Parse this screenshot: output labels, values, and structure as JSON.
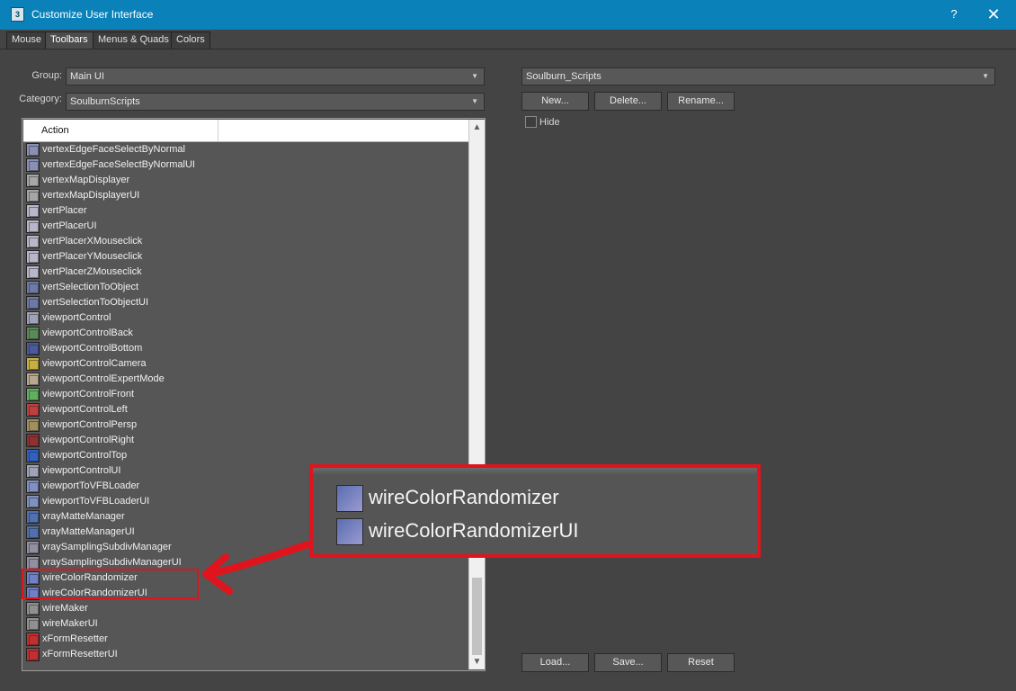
{
  "window": {
    "title": "Customize User Interface",
    "help_glyph": "?",
    "close_glyph": "✕",
    "icon_text": "3"
  },
  "tabs": [
    {
      "label": "Mouse"
    },
    {
      "label": "Toolbars"
    },
    {
      "label": "Menus & Quads"
    },
    {
      "label": "Colors"
    }
  ],
  "group": {
    "label": "Group:",
    "value": "Main UI"
  },
  "category": {
    "label": "Category:",
    "value": "SoulburnScripts"
  },
  "list": {
    "header": "Action",
    "rows": [
      {
        "label": "vertexEdgeFaceSelectByNormal",
        "icon_color": "#8a8fb3"
      },
      {
        "label": "vertexEdgeFaceSelectByNormalUI",
        "icon_color": "#8a8fb3"
      },
      {
        "label": "vertexMapDisplayer",
        "icon_color": "#a6a6a6"
      },
      {
        "label": "vertexMapDisplayerUI",
        "icon_color": "#a6a6a6"
      },
      {
        "label": "vertPlacer",
        "icon_color": "#b7b7c9"
      },
      {
        "label": "vertPlacerUI",
        "icon_color": "#b7b7c9"
      },
      {
        "label": "vertPlacerXMouseclick",
        "icon_color": "#b7b7c9"
      },
      {
        "label": "vertPlacerYMouseclick",
        "icon_color": "#b7b7c9"
      },
      {
        "label": "vertPlacerZMouseclick",
        "icon_color": "#b7b7c9"
      },
      {
        "label": "vertSelectionToObject",
        "icon_color": "#6e7aa6"
      },
      {
        "label": "vertSelectionToObjectUI",
        "icon_color": "#6e7aa6"
      },
      {
        "label": "viewportControl",
        "icon_color": "#9ea3b8"
      },
      {
        "label": "viewportControlBack",
        "icon_color": "#5a8a5a"
      },
      {
        "label": "viewportControlBottom",
        "icon_color": "#4a5a9a"
      },
      {
        "label": "viewportControlCamera",
        "icon_color": "#c8b040"
      },
      {
        "label": "viewportControlExpertMode",
        "icon_color": "#b8a890"
      },
      {
        "label": "viewportControlFront",
        "icon_color": "#60b060"
      },
      {
        "label": "viewportControlLeft",
        "icon_color": "#c04040"
      },
      {
        "label": "viewportControlPersp",
        "icon_color": "#a09060"
      },
      {
        "label": "viewportControlRight",
        "icon_color": "#903030"
      },
      {
        "label": "viewportControlTop",
        "icon_color": "#3060c0"
      },
      {
        "label": "viewportControlUI",
        "icon_color": "#9ea3b8"
      },
      {
        "label": "viewportToVFBLoader",
        "icon_color": "#8090c0"
      },
      {
        "label": "viewportToVFBLoaderUI",
        "icon_color": "#8090c0"
      },
      {
        "label": "vrayMatteManager",
        "icon_color": "#5070b0"
      },
      {
        "label": "vrayMatteManagerUI",
        "icon_color": "#5070b0"
      },
      {
        "label": "vraySamplingSubdivManager",
        "icon_color": "#9090a0"
      },
      {
        "label": "vraySamplingSubdivManagerUI",
        "icon_color": "#9090a0"
      },
      {
        "label": "wireColorRandomizer",
        "icon_color": "#7080c8"
      },
      {
        "label": "wireColorRandomizerUI",
        "icon_color": "#7080c8"
      },
      {
        "label": "wireMaker",
        "icon_color": "#909090"
      },
      {
        "label": "wireMakerUI",
        "icon_color": "#909090"
      },
      {
        "label": "xFormResetter",
        "icon_color": "#c03030"
      },
      {
        "label": "xFormResetterUI",
        "icon_color": "#c03030"
      }
    ]
  },
  "toolbar_select": {
    "value": "Soulburn_Scripts"
  },
  "buttons": {
    "new": "New...",
    "delete": "Delete...",
    "rename": "Rename...",
    "load": "Load...",
    "save": "Save...",
    "reset": "Reset"
  },
  "hide": {
    "label": "Hide"
  },
  "callout": {
    "line1": "wireColorRandomizer",
    "line2": "wireColorRandomizerUI"
  },
  "colors": {
    "title_bar": "#0a81b8",
    "annotation_red": "#e0141c",
    "panel": "#444444"
  }
}
